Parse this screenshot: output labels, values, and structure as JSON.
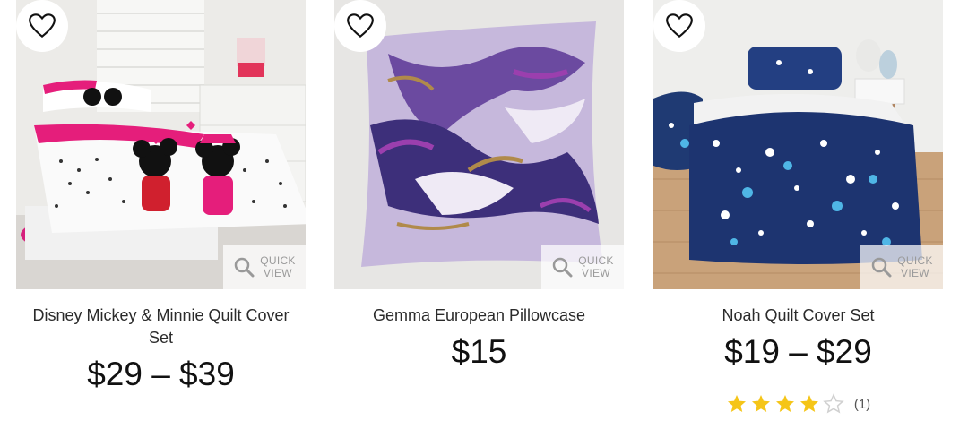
{
  "products": [
    {
      "name": "Disney Mickey & Minnie Quilt Cover Set",
      "price": "$29 – $39",
      "quick_view": [
        "QUICK",
        "VIEW"
      ]
    },
    {
      "name": "Gemma European Pillowcase",
      "price": "$15",
      "quick_view": [
        "QUICK",
        "VIEW"
      ]
    },
    {
      "name": "Noah Quilt Cover Set",
      "price": "$19 – $29",
      "quick_view": [
        "QUICK",
        "VIEW"
      ],
      "rating": {
        "stars": 4,
        "max": 5,
        "count_label": "(1)"
      }
    }
  ],
  "colors": {
    "star": "#f5c518",
    "star_empty": "#d0d0d0",
    "quick_view_text": "#9a9a9a"
  }
}
